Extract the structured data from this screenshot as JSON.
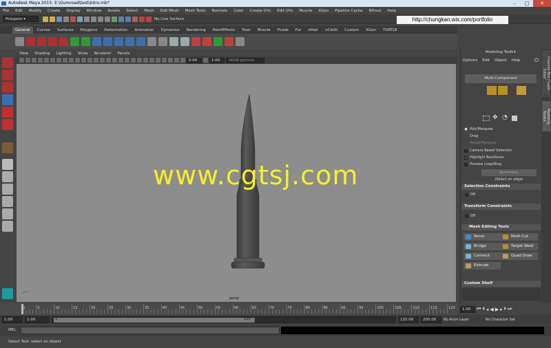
{
  "window": {
    "title": "Autodesk Maya 2015: E:\\Gumroad\\test\\Intro.mb*"
  },
  "menu": [
    "File",
    "Edit",
    "Modify",
    "Create",
    "Display",
    "Window",
    "Assets",
    "Select",
    "Mesh",
    "Edit Mesh",
    "Mesh Tools",
    "Normals",
    "Color",
    "Create UVs",
    "Edit UVs",
    "Muscle",
    "XGen",
    "Pipeline Cache",
    "Bifrost",
    "Help"
  ],
  "status": {
    "menuset": "Polygons",
    "live_surface": "No Live Surface"
  },
  "watermark_url": "http://chungkan.wix.com/portfolio",
  "shelf_tabs": [
    "General",
    "Curves",
    "Surfaces",
    "Polygons",
    "Deformation",
    "Animation",
    "Dynamics",
    "Rendering",
    "PaintEffects",
    "Toon",
    "Muscle",
    "Fluids",
    "Fur",
    "nHair",
    "nCloth",
    "Custom",
    "XGen",
    "TURTLE"
  ],
  "shelf_active": "General",
  "viewport": {
    "menu": [
      "View",
      "Shading",
      "Lighting",
      "Show",
      "Renderer",
      "Panels"
    ],
    "near": "0.00",
    "far": "1.00",
    "colorspace": "sRGB gamma",
    "camera": "persp",
    "overlay_text": "www.cgtsj.com"
  },
  "modeling_toolkit": {
    "title": "Modeling Toolkit",
    "menu": [
      "Options",
      "Edit",
      "Object",
      "Help"
    ],
    "multi_component": "Multi-Component",
    "options": [
      {
        "label": "Pick/Marquee",
        "mark": "●",
        "dim": false
      },
      {
        "label": "Drag",
        "mark": "",
        "dim": false
      },
      {
        "label": "Tweak/Marquee",
        "mark": "",
        "dim": true
      },
      {
        "label": "Camera Based Selection",
        "mark": "",
        "dim": false
      },
      {
        "label": "Highlight Backfaces",
        "mark": "✓",
        "dim": false
      },
      {
        "label": "Preview Loop/Ring",
        "mark": "",
        "dim": false
      }
    ],
    "symmetry": "Symmetry",
    "select_edge": "(Select an edge)",
    "selection_constraints": "Selection Constraints",
    "transform_constraints": "Transform Constraints",
    "off": "Off",
    "mesh_editing_tools": "Mesh Editing Tools",
    "tools": [
      "Bevel",
      "Multi-Cut",
      "Bridge",
      "Target Weld",
      "Connect",
      "Quad Draw",
      "Extrude"
    ],
    "custom_shelf": "Custom Shelf"
  },
  "side_tabs": [
    "Channel Box / Layer Editor",
    "Modeling Toolkit"
  ],
  "time_slider": {
    "ticks": [
      "1",
      "5",
      "10",
      "15",
      "20",
      "25",
      "30",
      "35",
      "40",
      "45",
      "50",
      "55",
      "60",
      "65",
      "70",
      "75",
      "80",
      "85",
      "90",
      "95",
      "100",
      "105",
      "110",
      "115",
      "120"
    ],
    "current": "1.00"
  },
  "range_slider": {
    "start": "1.00",
    "playback_start": "1.00",
    "range_start": "1",
    "range_end": "120",
    "playback_end": "120.00",
    "end": "200.00",
    "anim_layer": "No Anim Layer",
    "character_set": "No Character Set"
  },
  "command_line": {
    "label": "MEL"
  },
  "help_line": "Select Tool: select an object",
  "colors": {
    "viewport_bg": "#8d8d8d",
    "watermark": "#f5f02a",
    "ui_bg": "#444444"
  }
}
